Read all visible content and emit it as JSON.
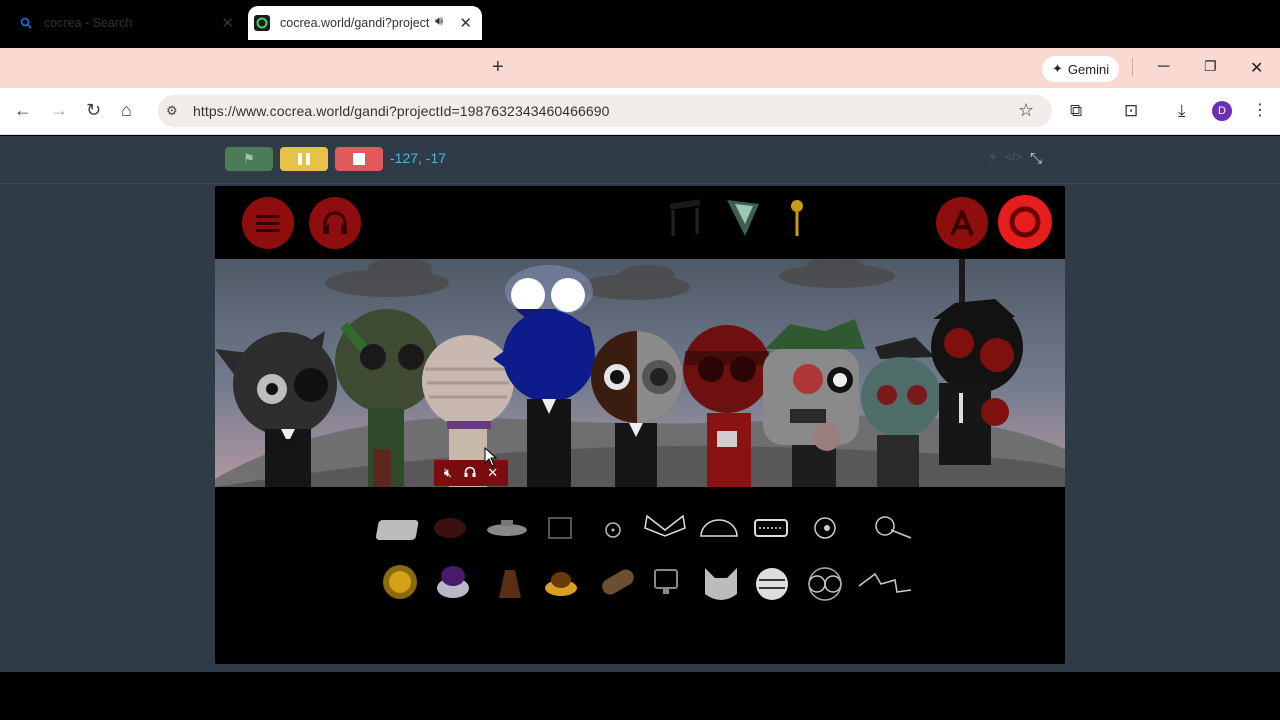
{
  "browser": {
    "tabs": [
      {
        "title": "cocrea - Search",
        "active": false
      },
      {
        "title": "cocrea.world/gandi?projectI",
        "active": true,
        "audio": true
      }
    ],
    "gemini_label": "Gemini",
    "url": "https://www.cocrea.world/gandi?projectId=1987632343460466690",
    "avatar_letter": "D"
  },
  "stage_controls": {
    "coords": "-127,  -17"
  },
  "mixer": {
    "mute": "mute-icon",
    "solo": "headphones-icon",
    "remove": "close-icon"
  },
  "colors": {
    "chrome_tabbar": "#f9d9d2",
    "page_bg": "#2f3c48",
    "accent_red": "#8e0d0d",
    "coords": "#4bb3e6"
  }
}
